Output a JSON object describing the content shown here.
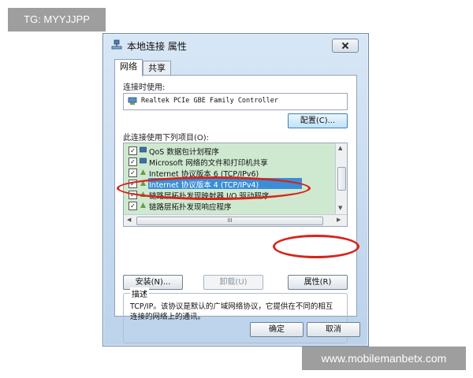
{
  "overlay": {
    "tag": "TG: MYYJJPP",
    "watermark": "www.mobilemanbetx.com"
  },
  "dialog": {
    "title": "本地连接 属性",
    "tabs": [
      {
        "label": "网络"
      },
      {
        "label": "共享"
      }
    ],
    "connect_using_label": "连接时使用:",
    "adapter_name": "Realtek PCIe GBE Family Controller",
    "configure_button": "配置(C)...",
    "items_label": "此连接使用下列项目(O):",
    "items": [
      {
        "label": "QoS 数据包计划程序",
        "checked": true,
        "icon": "network-service-icon"
      },
      {
        "label": "Microsoft 网络的文件和打印机共享",
        "checked": true,
        "icon": "network-service-icon"
      },
      {
        "label": "Internet 协议版本 6 (TCP/IPv6)",
        "checked": true,
        "icon": "protocol-icon"
      },
      {
        "label": "Internet 协议版本 4 (TCP/IPv4)",
        "checked": true,
        "icon": "protocol-icon",
        "selected": true
      },
      {
        "label": "链路层拓扑发现映射器 I/O 驱动程序",
        "checked": true,
        "icon": "protocol-icon"
      },
      {
        "label": "链路层拓扑发现响应程序",
        "checked": true,
        "icon": "protocol-icon"
      }
    ],
    "scroll_grip": "III",
    "install_button": "安装(N)...",
    "uninstall_button": "卸载(U)",
    "properties_button": "属性(R)",
    "description_title": "描述",
    "description_text": "TCP/IP。该协议是默认的广域网络协议，它提供在不同的相互连接的网络上的通讯。",
    "ok_button": "确定",
    "cancel_button": "取消"
  },
  "colors": {
    "highlight": "#d6241c",
    "selection": "#3a8ed8",
    "list_bg": "#cfe9d0"
  }
}
